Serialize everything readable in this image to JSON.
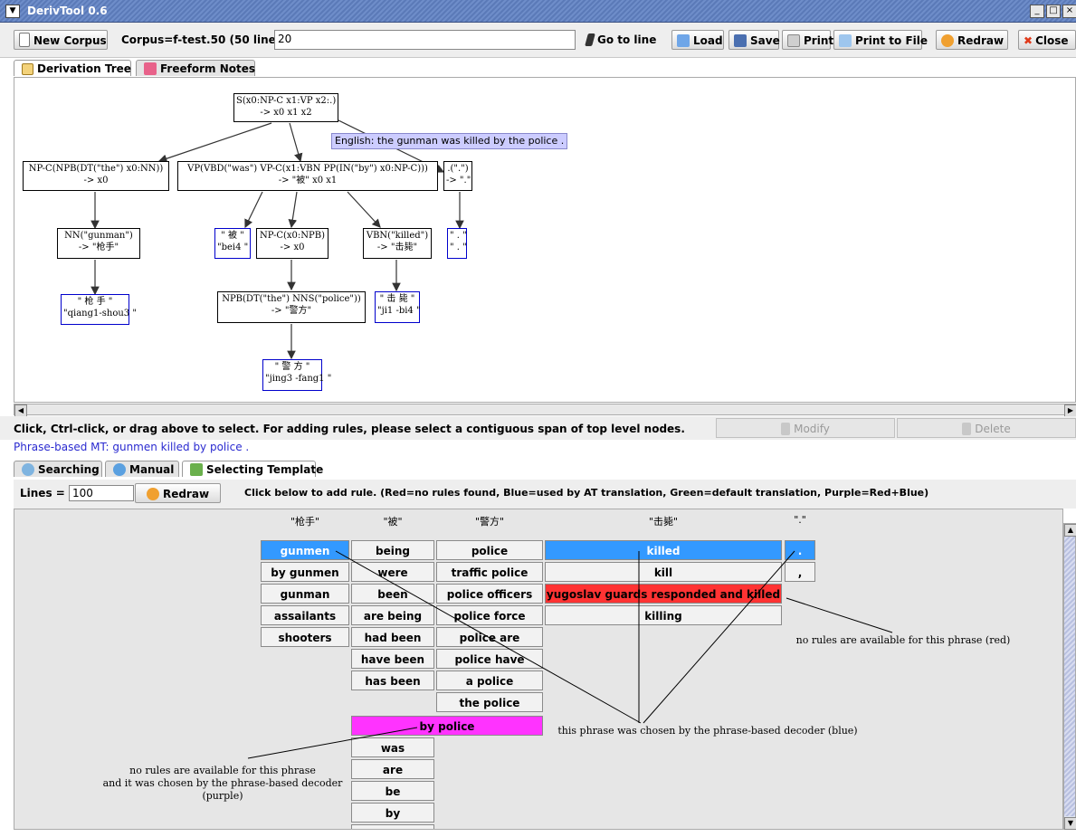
{
  "window": {
    "title": "DerivTool 0.6"
  },
  "toolbar": {
    "new_corpus": "New Corpus",
    "corpus_label": "Corpus=f-test.50 (50 lines)",
    "line_value": "20",
    "goto": "Go to line",
    "load": "Load",
    "save": "Save",
    "print": "Print",
    "print_file": "Print to File",
    "redraw": "Redraw",
    "close": "Close"
  },
  "tabs": [
    "Derivation Tree",
    "Freeform Notes"
  ],
  "tree": {
    "root": [
      "S(x0:NP-C x1:VP x2:.)",
      "-> x0 x1 x2"
    ],
    "english": "English: the gunman was killed by the police .",
    "np": [
      "NP-C(NPB(DT(\"the\") x0:NN))",
      "-> x0"
    ],
    "vp": [
      "VP(VBD(\"was\") VP-C(x1:VBN PP(IN(\"by\") x0:NP-C)))",
      "-> \"被\" x0 x1"
    ],
    "dot": [
      ".(\".\")",
      "-> \".\""
    ],
    "nn": [
      "NN(\"gunman\")",
      "-> \"枪手\""
    ],
    "bei": [
      "\" 被 \"",
      "\"bei4 \""
    ],
    "npc": [
      "NP-C(x0:NPB)",
      "-> x0"
    ],
    "vbn": [
      "VBN(\"killed\")",
      "-> \"击毙\""
    ],
    "dotleaf": [
      "\" . \"",
      "\" . \""
    ],
    "qiang": [
      "\" 枪   手 \"",
      "\"qiang1-shou3 \""
    ],
    "npb": [
      "NPB(DT(\"the\") NNS(\"police\"))",
      "-> \"警方\""
    ],
    "jibi": [
      "\" 击 毙 \"",
      "\"ji1 -bi4 \""
    ],
    "jing": [
      "\" 警   方 \"",
      "\"jing3 -fang1 \""
    ]
  },
  "status": {
    "hint": "Click, Ctrl-click, or drag above to select.  For adding rules, please select a contiguous span of top level nodes.",
    "modify": "Modify",
    "delete": "Delete",
    "phrase_mt": "Phrase-based MT:  gunmen killed by police ."
  },
  "lower_tabs": [
    "Searching",
    "Manual",
    "Selecting Template"
  ],
  "lower": {
    "lines_label": "Lines =",
    "lines_value": "100",
    "redraw": "Redraw",
    "instructions": "Click below to add rule.    (Red=no rules found, Blue=used by AT translation, Green=default translation, Purple=Red+Blue)"
  },
  "grid": {
    "headers": [
      "\"枪手\"",
      "\"被\"",
      "\"警方\"",
      "\"击毙\"",
      "\".\""
    ],
    "col1": [
      "gunmen",
      "by gunmen",
      "gunman",
      "assailants",
      "shooters"
    ],
    "col2": [
      "being",
      "were",
      "been",
      "are being",
      "had been",
      "have been",
      "has been"
    ],
    "col3": [
      "police",
      "traffic police",
      "police officers",
      "police force",
      "police are",
      "police have",
      "a police",
      "the police"
    ],
    "col4": [
      "killed",
      "kill",
      "yugoslav guards responded and killed",
      "killing"
    ],
    "col5": [
      ".",
      ","
    ],
    "span": "by police",
    "col2b": [
      "was",
      "are",
      "be",
      "by"
    ],
    "notes": {
      "red": "no rules are available for this phrase (red)",
      "blue": "this phrase was chosen by the phrase-based decoder (blue)",
      "purple_1": "no rules are available for this phrase",
      "purple_2": "and it was chosen by the phrase-based decoder",
      "purple_3": "(purple)"
    }
  },
  "colors": {
    "blue": "#3399ff",
    "red": "#ff3333",
    "purple": "#ff33ff",
    "title_bar": "#6e8dc9"
  }
}
